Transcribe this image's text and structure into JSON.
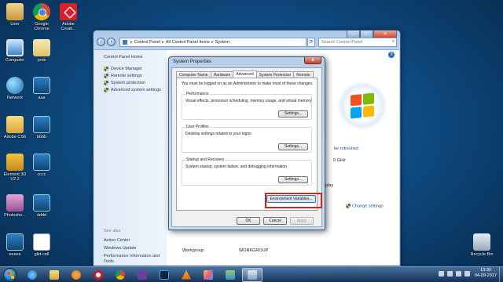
{
  "desktop": {
    "icons": [
      {
        "label": "User",
        "icon": "user-folder-icon"
      },
      {
        "label": "Google Chrome",
        "icon": "chrome-icon"
      },
      {
        "label": "Adobe Creati...",
        "icon": "adobe-cc-icon"
      },
      {
        "label": "Computer",
        "icon": "computer-icon"
      },
      {
        "label": "prob",
        "icon": "file-icon"
      },
      {
        "label": "Network",
        "icon": "network-icon"
      },
      {
        "label": "aaa",
        "icon": "image-icon"
      },
      {
        "label": "Adobe CS6",
        "icon": "folder-icon"
      },
      {
        "label": "bbbb",
        "icon": "image-icon"
      },
      {
        "label": "Element 3D V2.2",
        "icon": "folder-icon"
      },
      {
        "label": "cccc",
        "icon": "image-icon"
      },
      {
        "label": "Photosho...",
        "icon": "folder-icon"
      },
      {
        "label": "dddd",
        "icon": "image-icon"
      },
      {
        "label": "eeeee",
        "icon": "image-icon"
      },
      {
        "label": "glid-cell",
        "icon": "file-icon"
      },
      {
        "label": "Recycle Bin",
        "icon": "recycle-bin-icon"
      }
    ]
  },
  "explorer": {
    "breadcrumb": [
      "Control Panel",
      "All Control Panel Items",
      "System"
    ],
    "search_placeholder": "Search Control Panel",
    "left": {
      "home": "Control Panel Home",
      "tasks": [
        "Device Manager",
        "Remote settings",
        "System protection",
        "Advanced system settings"
      ],
      "see_also": "See also",
      "see_also_links": [
        "Action Center",
        "Windows Update",
        "Performance Information and Tools"
      ]
    },
    "partial": {
      "refreshed": "be refreshed",
      "ghz": "0 GHz",
      "play": "play",
      "change_settings": "Change settings",
      "workgroup_label": "Workgroup:",
      "workgroup_value": "WORKGROUP"
    }
  },
  "dialog": {
    "title": "System Properties",
    "close_label": "x",
    "tabs": [
      "Computer Name",
      "Hardware",
      "Advanced",
      "System Protection",
      "Remote"
    ],
    "active_tab": "Advanced",
    "note": "You must be logged on as an Administrator to make most of these changes.",
    "performance": {
      "legend": "Performance",
      "desc": "Visual effects, processor scheduling, memory usage, and virtual memory",
      "button": "Settings..."
    },
    "user_profiles": {
      "legend": "User Profiles",
      "desc": "Desktop settings related to your logon",
      "button": "Settings..."
    },
    "startup": {
      "legend": "Startup and Recovery",
      "desc": "System startup, system failure, and debugging information",
      "button": "Settings..."
    },
    "env_button": "Environment Variables...",
    "ok": "OK",
    "cancel": "Cancel",
    "apply": "Apply"
  },
  "taskbar": {
    "items": [
      "ie-icon",
      "folder-icon",
      "media-player-icon",
      "opera-icon",
      "chrome-icon",
      "visual-studio-icon",
      "photoshop-icon",
      "vlc-icon",
      "paint-icon",
      "gallery-icon",
      "system-icon"
    ],
    "time": "13:30",
    "date": "04-09-2017"
  }
}
